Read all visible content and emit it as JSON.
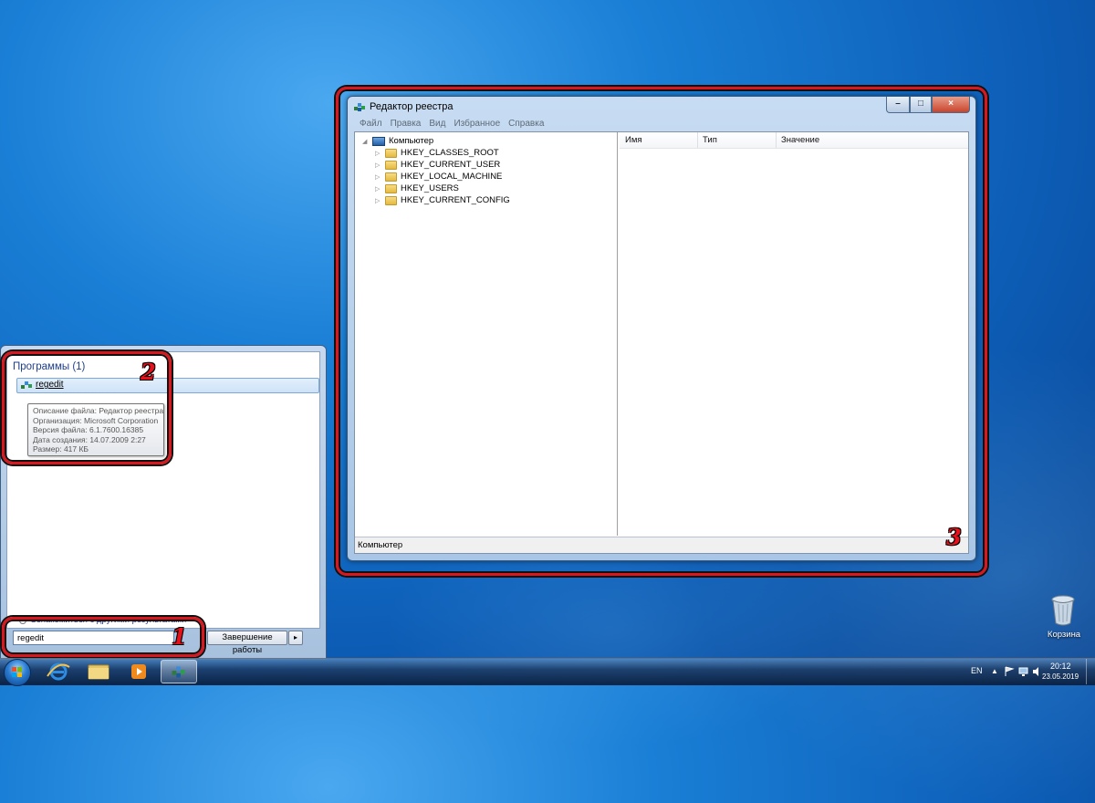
{
  "regedit": {
    "title": "Редактор реестра",
    "menu": [
      "Файл",
      "Правка",
      "Вид",
      "Избранное",
      "Справка"
    ],
    "tree_root": "Компьютер",
    "hives": [
      "HKEY_CLASSES_ROOT",
      "HKEY_CURRENT_USER",
      "HKEY_LOCAL_MACHINE",
      "HKEY_USERS",
      "HKEY_CURRENT_CONFIG"
    ],
    "columns": [
      "Имя",
      "Тип",
      "Значение"
    ],
    "status": "Компьютер",
    "caption_buttons": {
      "minimize": "–",
      "maximize": "□",
      "close": "×"
    }
  },
  "start_menu": {
    "section_title": "Программы (1)",
    "result_label": "regedit",
    "tooltip": [
      "Описание файла: Редактор реестра",
      "Организация: Microsoft Corporation",
      "Версия файла: 6.1.7600.16385",
      "Дата создания: 14.07.2009 2:27",
      "Размер: 417 КБ"
    ],
    "more_results": "Ознакомиться с другими результатами",
    "search_value": "regedit",
    "shutdown_label": "Завершение работы",
    "shutdown_arrow": "▸"
  },
  "annotations": {
    "one": "1",
    "two": "2",
    "three": "3"
  },
  "desktop": {
    "recycle_bin_label": "Корзина"
  },
  "tray": {
    "language": "EN",
    "time": "20:12",
    "date": "23.05.2019"
  }
}
